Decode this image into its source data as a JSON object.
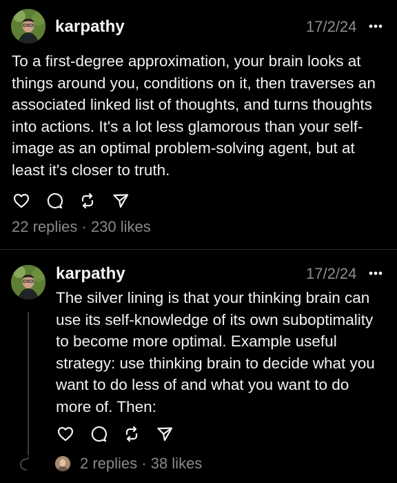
{
  "posts": [
    {
      "username": "karpathy",
      "date": "17/2/24",
      "text": "To a first-degree approximation, your brain looks at\nthings around you, conditions on it, then traverses an\nassociated linked list of thoughts, and turns thoughts\ninto actions. It's a lot less glamorous than your self-\nimage as an optimal problem-solving agent, but at\nleast it's closer to truth.",
      "stats": "22 replies · 230 likes"
    },
    {
      "username": "karpathy",
      "date": "17/2/24",
      "text": "The silver lining is that your thinking brain can\nuse its self-knowledge of its own suboptimality\nto become more optimal. Example useful\nstrategy: use thinking brain to decide what you\nwant to do less of and what you want to do\nmore of. Then:",
      "stats": "2 replies · 38 likes"
    }
  ],
  "icons": {
    "more": "more-horizontal-icon",
    "like": "heart-icon",
    "reply": "comment-icon",
    "repost": "repost-icon",
    "share": "send-icon"
  },
  "colors": {
    "background": "#000000",
    "text": "#f2f2f2",
    "muted": "#8a8a8a",
    "divider": "#2a2a2a"
  }
}
